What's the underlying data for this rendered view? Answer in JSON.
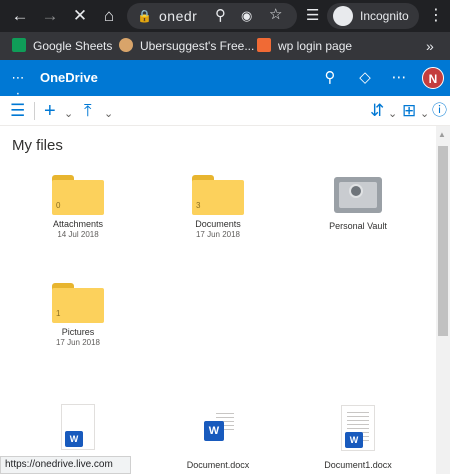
{
  "browser": {
    "address_text": "onedr",
    "incognito_label": "Incognito",
    "bookmarks": [
      {
        "label": "Google Sheets",
        "color": "#0f9d58"
      },
      {
        "label": "Ubersuggest's Free...",
        "color": "#d8a46a"
      },
      {
        "label": "wp login page",
        "color": "#f06a35"
      }
    ],
    "more_label": "»"
  },
  "onedrive": {
    "title": "OneDrive",
    "avatar_initial": "N",
    "brand_color": "#0078d4"
  },
  "page_title": "My files",
  "folders": [
    {
      "name": "Attachments",
      "date": "14 Jul 2018",
      "count": "0"
    },
    {
      "name": "Documents",
      "date": "17 Jun 2018",
      "count": "3"
    },
    {
      "name": "Pictures",
      "date": "17 Jun 2018",
      "count": "1"
    }
  ],
  "vault": {
    "name": "Personal Vault"
  },
  "documents": [
    {
      "name": "Document.docx"
    },
    {
      "name": "Document1.docx"
    }
  ],
  "status_url": "https://onedrive.live.com"
}
